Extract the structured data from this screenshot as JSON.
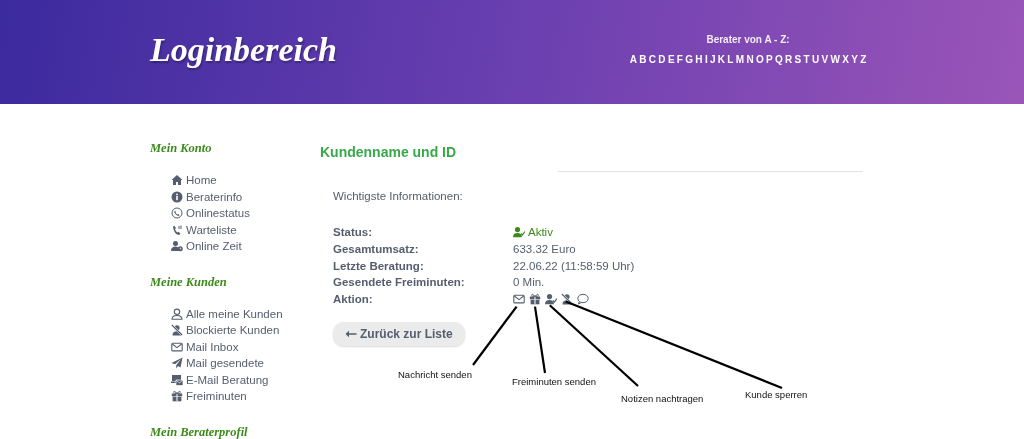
{
  "header": {
    "title": "Loginbereich",
    "az_heading": "Berater von A - Z:",
    "letters": [
      "A",
      "B",
      "C",
      "D",
      "E",
      "F",
      "G",
      "H",
      "I",
      "J",
      "K",
      "L",
      "M",
      "N",
      "O",
      "P",
      "Q",
      "R",
      "S",
      "T",
      "U",
      "V",
      "W",
      "X",
      "Y",
      "Z"
    ]
  },
  "sidebar": {
    "sections": [
      {
        "title": "Mein Konto",
        "items": [
          {
            "kind": "home",
            "label": "Home"
          },
          {
            "kind": "info",
            "label": "Beraterinfo"
          },
          {
            "kind": "phone-circle",
            "label": "Onlinestatus"
          },
          {
            "kind": "phone",
            "label": "Warteliste"
          },
          {
            "kind": "user-clock",
            "label": "Online Zeit"
          }
        ]
      },
      {
        "title": "Meine Kunden",
        "items": [
          {
            "kind": "user",
            "label": "Alle meine Kunden"
          },
          {
            "kind": "user-slash",
            "label": "Blockierte Kunden"
          },
          {
            "kind": "mail",
            "label": "Mail Inbox"
          },
          {
            "kind": "send",
            "label": "Mail gesendete"
          },
          {
            "kind": "mail-laptop",
            "label": "E-Mail Beratung"
          },
          {
            "kind": "gift",
            "label": "Freiminuten"
          }
        ]
      },
      {
        "title": "Mein Beraterprofil"
      }
    ]
  },
  "main": {
    "heading": "Kundenname und ID",
    "intro": "Wichtigste Informationen:",
    "fields": [
      {
        "kind": "status",
        "label": "Status:",
        "value": "Aktiv"
      },
      {
        "kind": "text",
        "label": "Gesamtumsatz:",
        "value": "633.32 Euro"
      },
      {
        "kind": "text",
        "label": "Letzte Beratung:",
        "value": "22.06.22 (11:58:59 Uhr)"
      },
      {
        "kind": "text",
        "label": "Gesendete Freiminuten:",
        "value": "0 Min."
      }
    ],
    "action_label": "Aktion:",
    "actions": [
      {
        "kind": "mail",
        "annotation": "Nachricht senden"
      },
      {
        "kind": "gift",
        "annotation": "Freiminuten senden"
      },
      {
        "kind": "user-check",
        "annotation": "Notizen nachtragen"
      },
      {
        "kind": "user-slash",
        "annotation": "Kunde sperren"
      },
      {
        "kind": "comment"
      }
    ],
    "back_button": "Zurück zur Liste"
  }
}
